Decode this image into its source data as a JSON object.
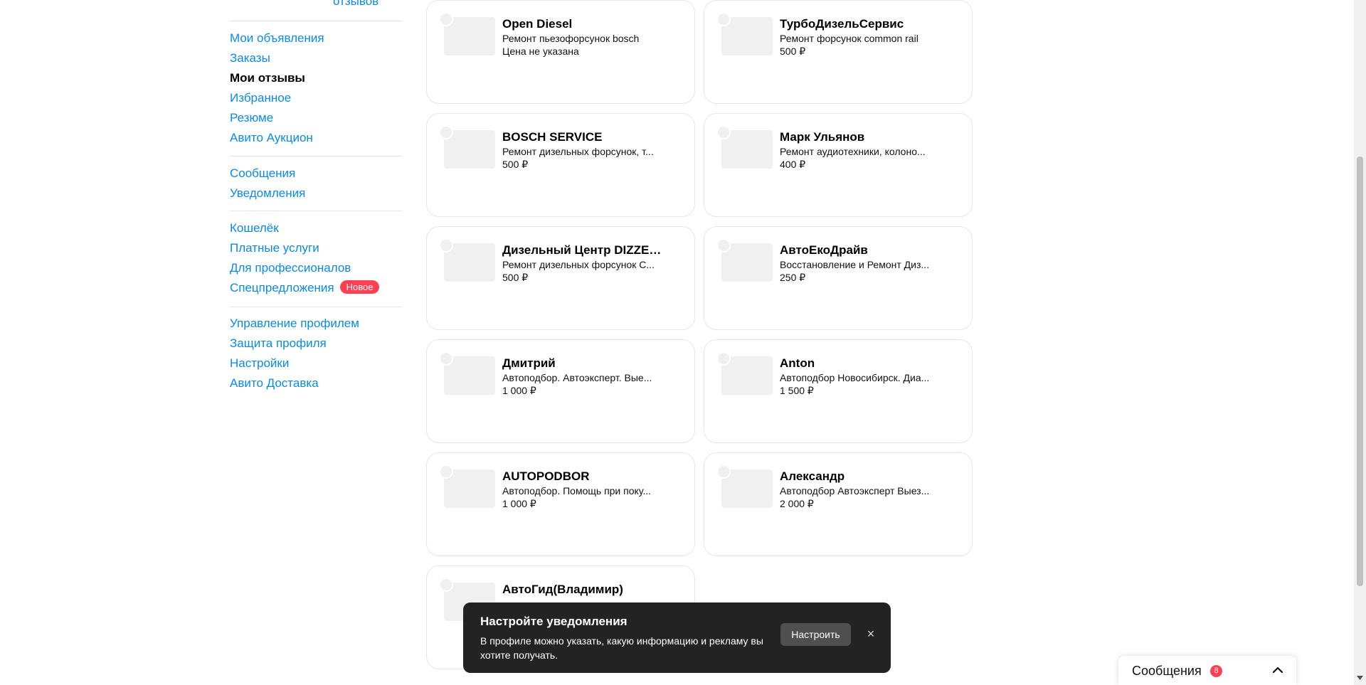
{
  "sidebar": {
    "top_link": "отзывов",
    "group1": [
      "Мои объявления",
      "Заказы",
      "Мои отзывы",
      "Избранное",
      "Резюме",
      "Авито Аукцион"
    ],
    "group2": [
      "Сообщения",
      "Уведомления"
    ],
    "group3": [
      "Кошелёк",
      "Платные услуги",
      "Для профессионалов",
      "Спецпредложения"
    ],
    "new_badge": "Новое",
    "group4": [
      "Управление профилем",
      "Защита профиля",
      "Настройки",
      "Авито Доставка"
    ]
  },
  "cards": [
    {
      "title": "Open Diesel",
      "desc": "Ремонт пьезофорсунок bosch",
      "price": "Цена не указана"
    },
    {
      "title": "ТурбоДизельСервис",
      "desc": "Ремонт форсунок common rail",
      "price": "500 ₽"
    },
    {
      "title": "BOSCH SERVICE",
      "desc": "Ремонт дизельных форсунок, т...",
      "price": "500 ₽"
    },
    {
      "title": "Марк Ульянов",
      "desc": "Ремонт аудиотехники, колоно...",
      "price": "400 ₽"
    },
    {
      "title": "Дизельный Центр DIZZEL ...",
      "desc": "Ремонт дизельных форсунок С...",
      "price": "500 ₽"
    },
    {
      "title": "АвтоЕкоДрайв",
      "desc": "Восстановление и Ремонт Диз...",
      "price": "250 ₽"
    },
    {
      "title": "Дмитрий",
      "desc": "Автоподбор. Автоэксперт. Вые...",
      "price": "1 000 ₽"
    },
    {
      "title": "Anton",
      "desc": "Автоподбор Новосибирск. Диа...",
      "price": "1 500 ₽"
    },
    {
      "title": "AUTOPODBOR",
      "desc": "Автоподбор. Помощь при поку...",
      "price": "1 000 ₽"
    },
    {
      "title": "Александр",
      "desc": "Автоподбор Автоэксперт Выез...",
      "price": "2 000 ₽"
    },
    {
      "title": "АвтоГид(Владимир)",
      "desc": "",
      "price": ""
    }
  ],
  "toast": {
    "title": "Настройте уведомления",
    "text": "В профиле можно указать, какую информацию и рекламу вы хотите получать.",
    "button": "Настроить",
    "close": "×"
  },
  "messages_widget": {
    "label": "Сообщения",
    "count": "8"
  },
  "colors": {
    "link": "#0a8ae6",
    "badge": "#ff4053",
    "toast_bg": "#232323"
  }
}
